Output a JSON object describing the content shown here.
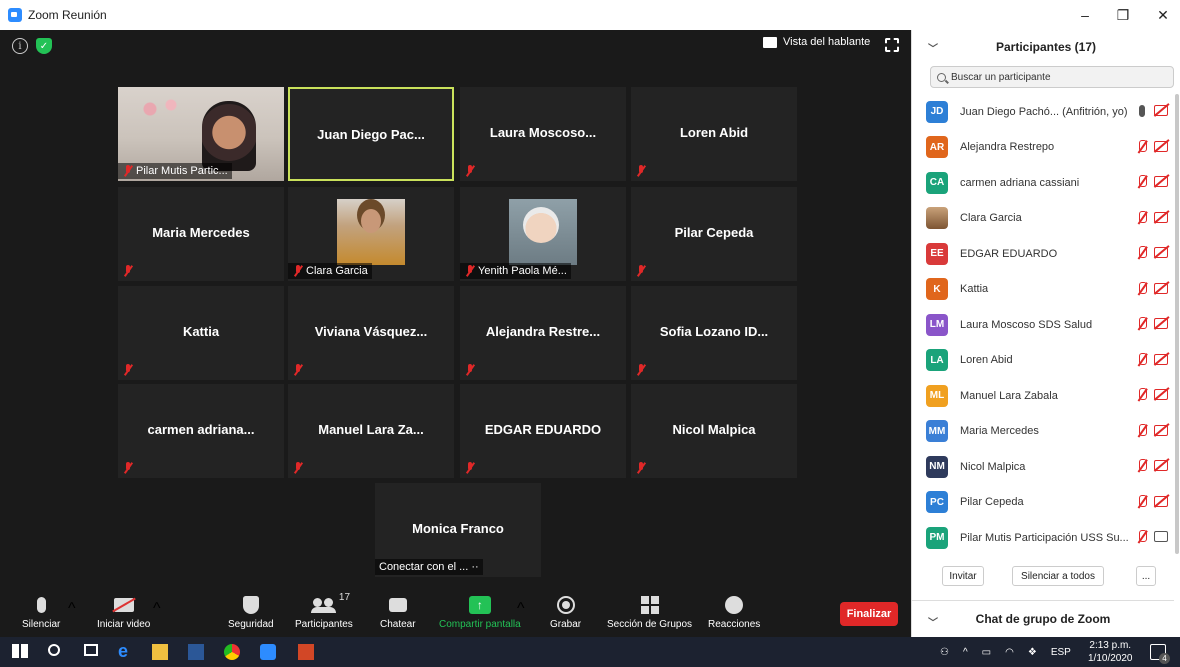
{
  "window": {
    "title": "Zoom Reunión",
    "controls": [
      "–",
      "❐",
      "✕"
    ]
  },
  "top_bar": {
    "speaker_view_label": "Vista del hablante"
  },
  "tiles": [
    {
      "name": "Pilar Mutis Partic...",
      "type": "video-pilar"
    },
    {
      "name": "Juan Diego Pac...",
      "type": "name",
      "active": true,
      "muted": false
    },
    {
      "name": "Laura Moscoso...",
      "type": "name"
    },
    {
      "name": "Loren Abid",
      "type": "name"
    },
    {
      "name": "Maria Mercedes",
      "type": "name"
    },
    {
      "name": "Clara Garcia",
      "type": "thumb-clara"
    },
    {
      "name": "Yenith Paola Mé...",
      "type": "thumb-yenith"
    },
    {
      "name": "Pilar Cepeda",
      "type": "name"
    },
    {
      "name": "Kattia",
      "type": "name"
    },
    {
      "name": "Viviana Vásquez...",
      "type": "name"
    },
    {
      "name": "Alejandra Restre...",
      "type": "name"
    },
    {
      "name": "Sofia Lozano ID...",
      "type": "name"
    },
    {
      "name": "carmen adriana...",
      "type": "name"
    },
    {
      "name": "Manuel Lara Za...",
      "type": "name"
    },
    {
      "name": "EDGAR EDUARDO",
      "type": "name"
    },
    {
      "name": "Nicol Malpica",
      "type": "name"
    },
    {
      "name": "Monica Franco",
      "type": "name",
      "caption": "Conectar con el ... ··",
      "muted": false
    }
  ],
  "toolbar": {
    "mute": "Silenciar",
    "video": "Iniciar video",
    "security": "Seguridad",
    "participants": "Participantes",
    "participant_count": "17",
    "chat": "Chatear",
    "share": "Compartir pantalla",
    "record": "Grabar",
    "breakout": "Sección de Grupos",
    "reactions": "Reacciones",
    "end": "Finalizar"
  },
  "panel": {
    "title": "Participantes (17)",
    "search_placeholder": "Buscar un participante",
    "participants": [
      {
        "initials": "JD",
        "name": "Juan Diego Pachó... (Anfitrión, yo)",
        "color": "#2d7fd6",
        "mic": "on",
        "cam": "off"
      },
      {
        "initials": "AR",
        "name": "Alejandra Restrepo",
        "color": "#e0661c",
        "mic": "off",
        "cam": "off"
      },
      {
        "initials": "CA",
        "name": "carmen adriana cassiani",
        "color": "#1aa37a",
        "mic": "off",
        "cam": "off"
      },
      {
        "initials": "",
        "name": "Clara Garcia",
        "color": "photo",
        "mic": "off",
        "cam": "off"
      },
      {
        "initials": "EE",
        "name": "EDGAR EDUARDO",
        "color": "#d93a3a",
        "mic": "off",
        "cam": "off"
      },
      {
        "initials": "K",
        "name": "Kattia",
        "color": "#e0661c",
        "mic": "off",
        "cam": "off"
      },
      {
        "initials": "LM",
        "name": "Laura Moscoso SDS Salud",
        "color": "#8a55c9",
        "mic": "off",
        "cam": "off"
      },
      {
        "initials": "LA",
        "name": "Loren Abid",
        "color": "#1aa37a",
        "mic": "off",
        "cam": "off"
      },
      {
        "initials": "ML",
        "name": "Manuel Lara Zabala",
        "color": "#f0a020",
        "mic": "off",
        "cam": "off"
      },
      {
        "initials": "MM",
        "name": "Maria Mercedes",
        "color": "#3a7fd6",
        "mic": "off",
        "cam": "off"
      },
      {
        "initials": "NM",
        "name": "Nicol Malpica",
        "color": "#2e3a5c",
        "mic": "off",
        "cam": "off"
      },
      {
        "initials": "PC",
        "name": "Pilar Cepeda",
        "color": "#2d7fd6",
        "mic": "off",
        "cam": "off"
      },
      {
        "initials": "PM",
        "name": "Pilar Mutis Participación USS Su...",
        "color": "#1aa37a",
        "mic": "off",
        "cam": "on"
      }
    ],
    "invite": "Invitar",
    "mute_all": "Silenciar a todos",
    "more": "...",
    "chat_title": "Chat de grupo de Zoom"
  },
  "taskbar": {
    "lang": "ESP",
    "time": "2:13 p.m.",
    "date": "1/10/2020",
    "notifications": "4"
  }
}
